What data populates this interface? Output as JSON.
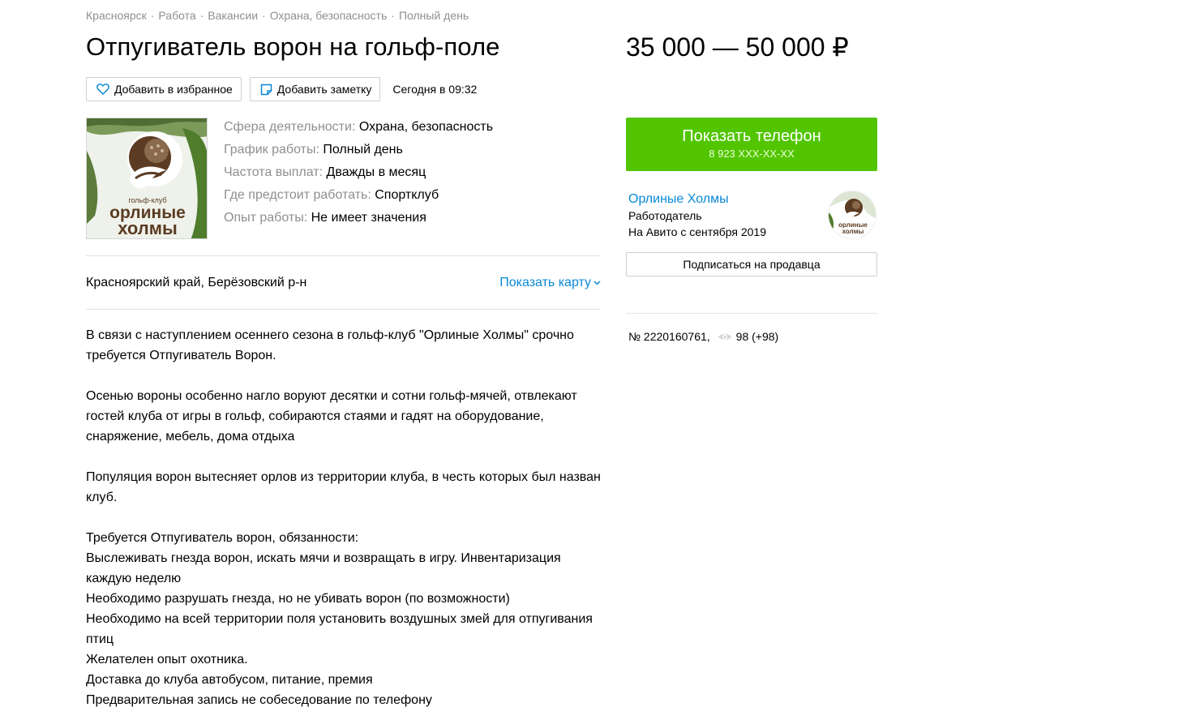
{
  "breadcrumbs": [
    "Красноярск",
    "Работа",
    "Вакансии",
    "Охрана, безопасность",
    "Полный день"
  ],
  "title": "Отпугиватель ворон на гольф-поле",
  "price": "35 000 — 50 000 ₽",
  "actions": {
    "favorite_label": "Добавить в избранное",
    "note_label": "Добавить заметку",
    "posted": "Сегодня в 09:32"
  },
  "logo": {
    "top_text": "гольф-клуб",
    "line1": "орлиные",
    "line2": "холмы"
  },
  "params": [
    {
      "key": "Сфера деятельности:",
      "value": "Охрана, безопасность"
    },
    {
      "key": "График работы:",
      "value": "Полный день"
    },
    {
      "key": "Частота выплат:",
      "value": "Дважды в месяц"
    },
    {
      "key": "Где предстоит работать:",
      "value": "Спортклуб"
    },
    {
      "key": "Опыт работы:",
      "value": "Не имеет значения"
    }
  ],
  "location": {
    "address": "Красноярский край, Берёзовский р-н",
    "map_link": "Показать карту"
  },
  "description": {
    "p1": "В связи с наступлением осеннего сезона в гольф-клуб \"Орлиные Холмы\" срочно требуется Отпугиватель Ворон.",
    "p2": "Осенью вороны особенно нагло воруют десятки и сотни гольф-мячей, отвлекают гостей клуба от игры в гольф, собираются стаями и гадят на оборудование, снаряжение, мебель, дома отдыха",
    "p3": "Популяция ворон вытесняет орлов из территории клуба, в честь которых был назван клуб.",
    "lines": [
      "Требуется Отпугиватель ворон, обязанности:",
      "Выслеживать гнезда ворон, искать мячи и возвращать в игру. Инвентаризация каждую неделю",
      "Необходимо разрушать гнезда, но не убивать ворон (по возможности)",
      "Необходимо на всей территории поля установить воздушных змей для отпугивания птиц",
      "Желателен опыт охотника.",
      "Доставка до клуба автобусом, питание, премия",
      "Предварительная запись не собеседование по телефону"
    ]
  },
  "contact": {
    "phone_label": "Показать телефон",
    "phone_masked": "8 923 XXX-XX-XX"
  },
  "seller": {
    "name": "Орлиные Холмы",
    "role": "Работодатель",
    "since": "На Авито с сентября 2019",
    "subscribe_label": "Подписаться на продавца"
  },
  "meta": {
    "item_number": "№ 2220160761,",
    "views": "98 (+98)"
  },
  "colors": {
    "accent_green": "#52c500",
    "link_blue": "#0a88d6",
    "muted_gray": "#8f8f8f"
  }
}
